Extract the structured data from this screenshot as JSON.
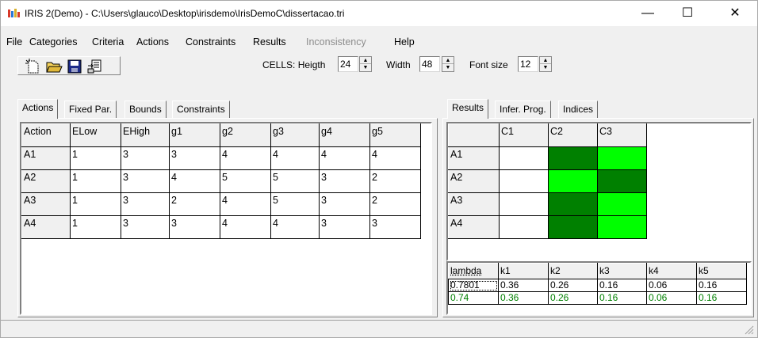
{
  "window": {
    "title": "IRIS 2(Demo)  -  C:\\Users\\glauco\\Desktop\\irisdemo\\IrisDemoC\\dissertacao.tri",
    "minimize_glyph": "—",
    "maximize_glyph": "☐",
    "close_glyph": "✕"
  },
  "menu": {
    "items": [
      {
        "label": "File",
        "enabled": true
      },
      {
        "label": "Categories",
        "enabled": true
      },
      {
        "label": "Criteria",
        "enabled": true
      },
      {
        "label": "Actions",
        "enabled": true
      },
      {
        "label": "Constraints",
        "enabled": true
      },
      {
        "label": "Results",
        "enabled": true
      },
      {
        "label": "Inconsistency",
        "enabled": false
      },
      {
        "label": "Help",
        "enabled": true
      }
    ]
  },
  "toolbar": {
    "icons": [
      "new-file-icon",
      "open-folder-icon",
      "save-disk-icon",
      "export-icon"
    ],
    "cells_label": "CELLS: Heigth",
    "height_value": "24",
    "width_label": "Width",
    "width_value": "48",
    "fontsize_label": "Font size",
    "fontsize_value": "12"
  },
  "left_panel": {
    "tabs": [
      "Actions",
      "Fixed Par.",
      "Bounds",
      "Constraints"
    ],
    "active_tab": "Actions",
    "headers": [
      "Action",
      "ELow",
      "EHigh",
      "g1",
      "g2",
      "g3",
      "g4",
      "g5"
    ],
    "rows": [
      [
        "A1",
        "1",
        "3",
        "3",
        "4",
        "4",
        "4",
        "4"
      ],
      [
        "A2",
        "1",
        "3",
        "4",
        "5",
        "5",
        "3",
        "2"
      ],
      [
        "A3",
        "1",
        "3",
        "2",
        "4",
        "5",
        "3",
        "2"
      ],
      [
        "A4",
        "1",
        "3",
        "3",
        "4",
        "4",
        "3",
        "3"
      ]
    ]
  },
  "right_panel": {
    "tabs": [
      "Results",
      "Infer. Prog.",
      "Indices"
    ],
    "active_tab": "Results",
    "categories": [
      "C1",
      "C2",
      "C3"
    ],
    "actions": [
      "A1",
      "A2",
      "A3",
      "A4"
    ],
    "colors": {
      "dark": "#008000",
      "light": "#00ff00",
      "empty": "#ffffff",
      "green_text": "#008000"
    },
    "assignment": [
      [
        "empty",
        "dark",
        "light"
      ],
      [
        "empty",
        "light",
        "dark"
      ],
      [
        "empty",
        "dark",
        "light"
      ],
      [
        "empty",
        "dark",
        "light"
      ]
    ],
    "param_headers": [
      "lambda",
      "k1",
      "k2",
      "k3",
      "k4",
      "k5"
    ],
    "param_row1": [
      "0.7801",
      "0.36",
      "0.26",
      "0.16",
      "0.06",
      "0.16"
    ],
    "param_row2": [
      "0.74",
      "0.36",
      "0.26",
      "0.16",
      "0.06",
      "0.16"
    ]
  }
}
